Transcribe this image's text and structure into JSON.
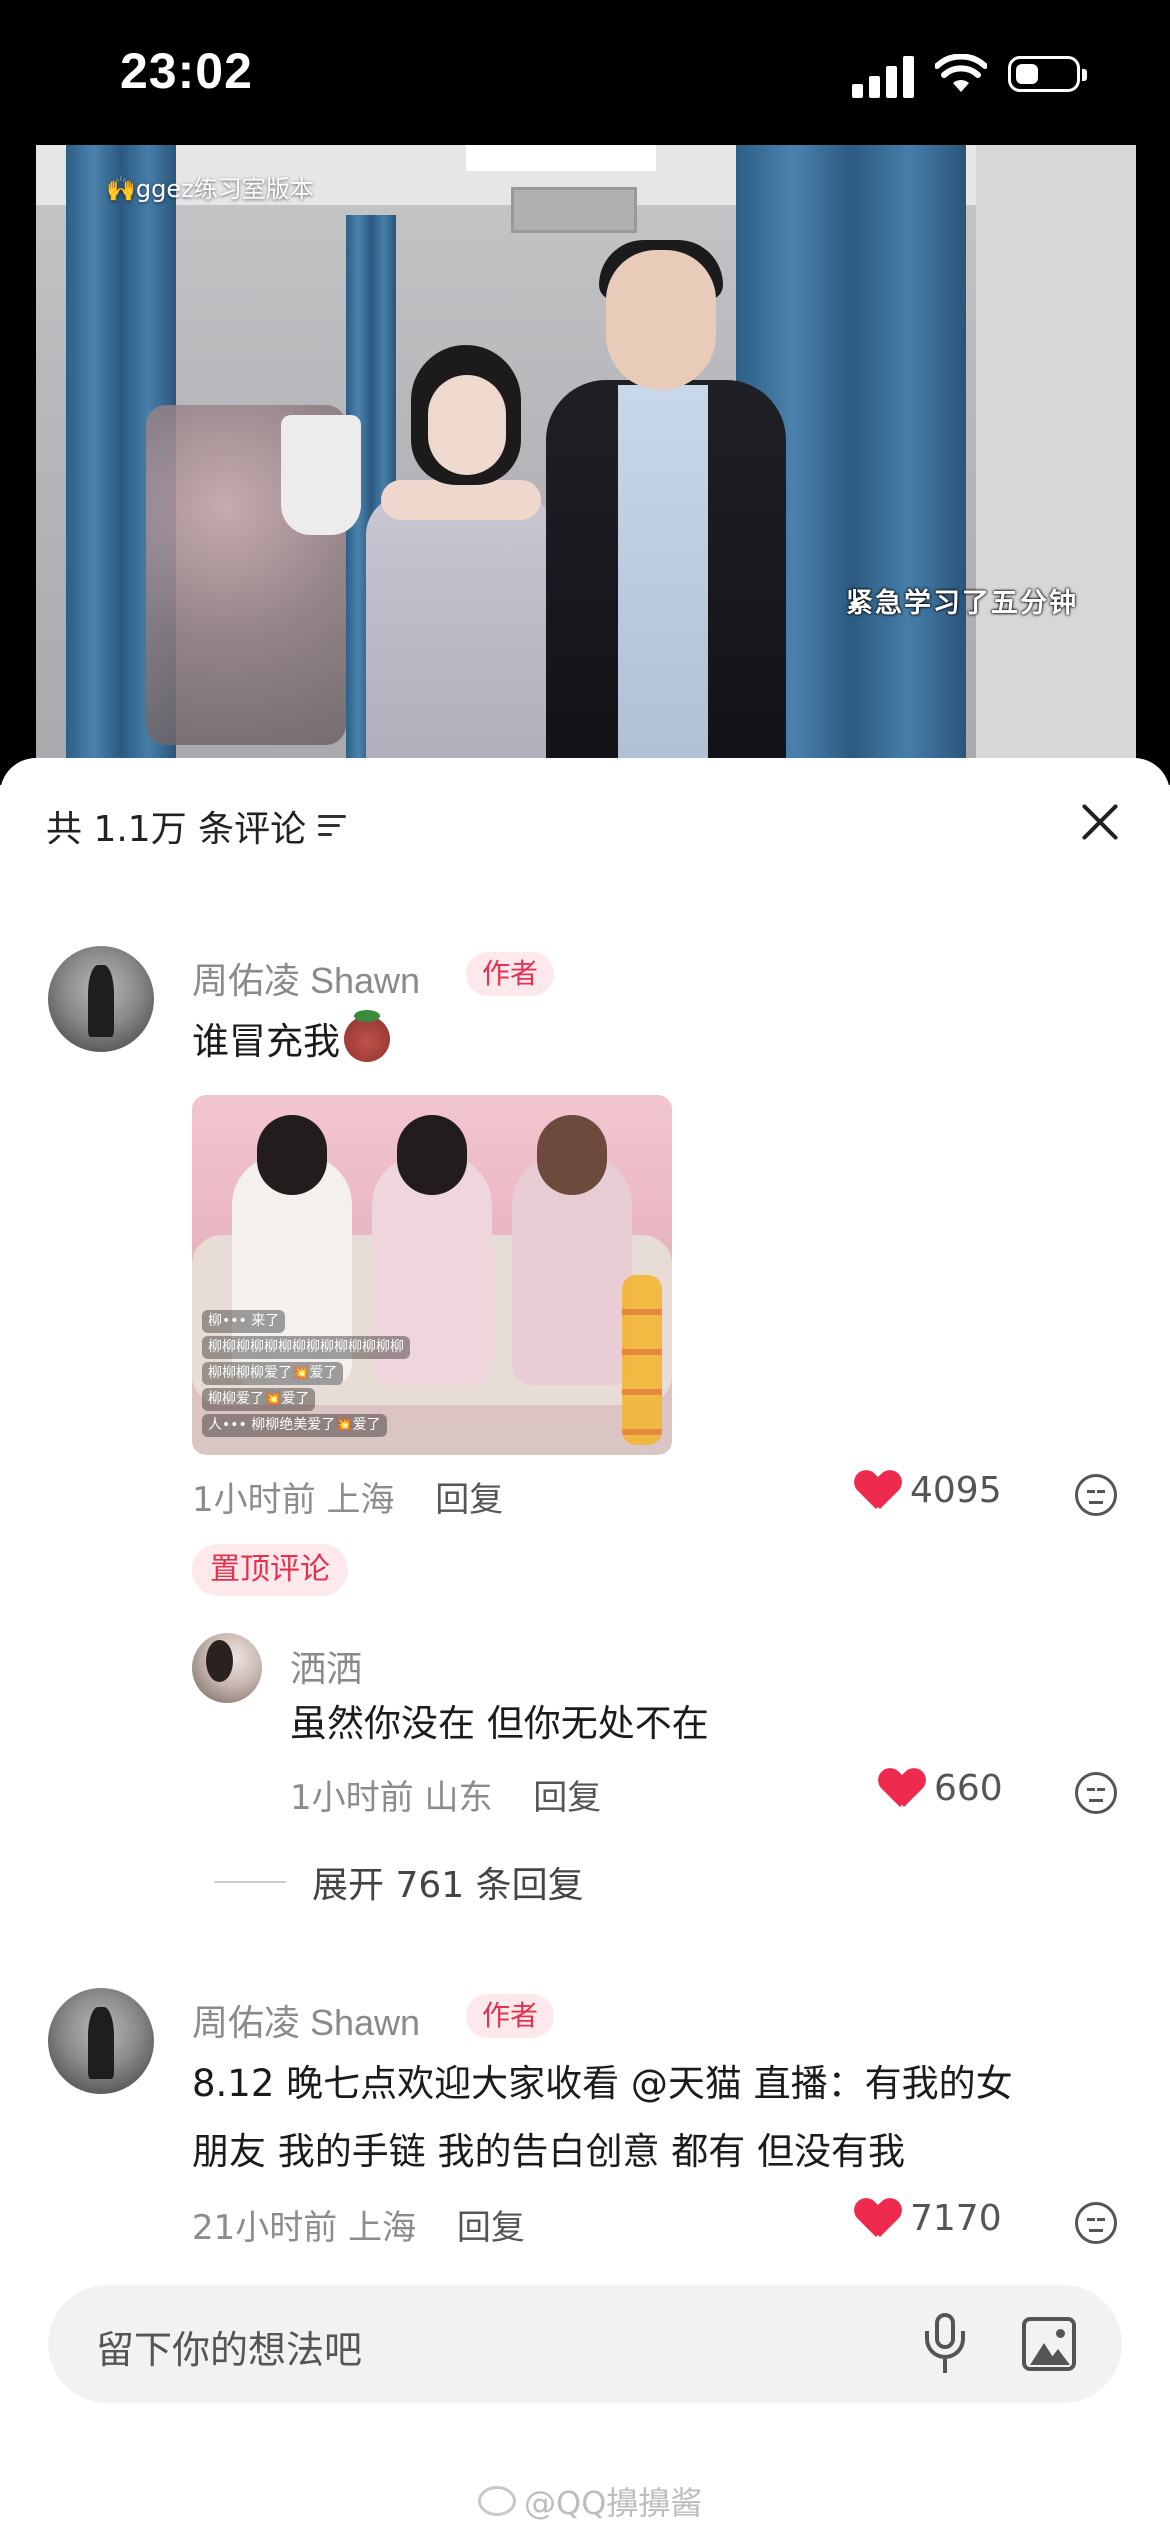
{
  "status_bar": {
    "time": "23:02"
  },
  "video": {
    "watermark": "🙌ggez练习室版本",
    "caption": "紧急学习了五分钟"
  },
  "comments_sheet": {
    "header": "共 1.1万 条评论",
    "comments": [
      {
        "user": "周佑凌 Shawn",
        "badge": "作者",
        "text": "谁冒充我",
        "image_chat": [
          "柳••• 来了",
          "柳柳柳柳柳柳柳柳柳柳柳柳柳柳",
          "柳柳柳柳爱了💥爱了",
          "柳柳爱了💥爱了",
          "人••• 柳柳绝美爱了💥爱了"
        ],
        "time": "1小时前",
        "location": "上海",
        "reply_label": "回复",
        "likes": "4095",
        "pinned_label": "置顶评论",
        "replies": [
          {
            "user": "洒洒",
            "text": "虽然你没在 但你无处不在",
            "time": "1小时前",
            "location": "山东",
            "reply_label": "回复",
            "likes": "660"
          }
        ],
        "expand_label": "展开 761 条回复"
      },
      {
        "user": "周佑凌 Shawn",
        "badge": "作者",
        "text_line1": "8.12 晚七点欢迎大家收看 @天猫 直播：有我的女",
        "text_line2": "朋友 我的手链 我的告白创意 都有 但没有我",
        "time": "21小时前",
        "location": "上海",
        "reply_label": "回复",
        "likes": "7170"
      }
    ]
  },
  "input": {
    "placeholder": "留下你的想法吧"
  },
  "watermark": "@QQ擤擤酱",
  "colors": {
    "accent": "#ee2a4e",
    "badge_bg": "#fde9ec",
    "badge_text": "#e5314d"
  }
}
